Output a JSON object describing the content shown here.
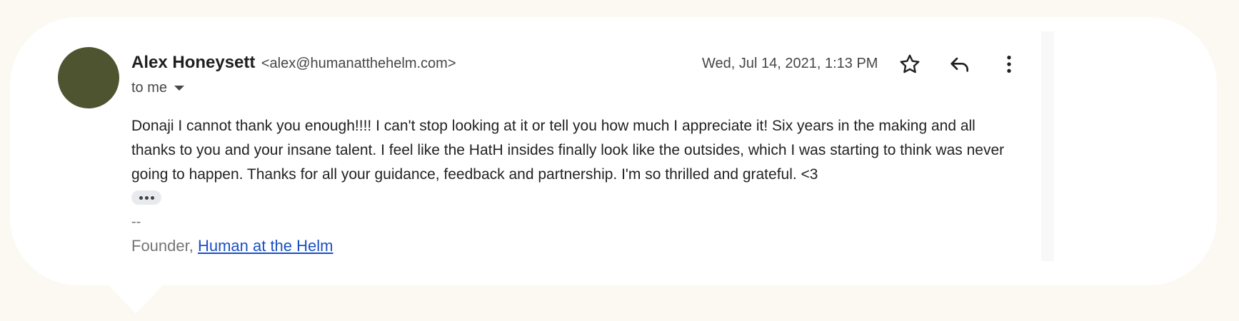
{
  "sender": {
    "name": "Alex Honeysett",
    "email": "<alex@humanatthehelm.com>",
    "avatar_color": "#4f5430"
  },
  "recipient": {
    "label": "to me"
  },
  "date": "Wed, Jul 14, 2021, 1:13 PM",
  "actions": {
    "star_icon": "star-icon",
    "reply_icon": "reply-icon",
    "more_icon": "more-vert-icon"
  },
  "message": {
    "body": "Donaji I cannot thank you enough!!!! I can't stop looking at it or tell you how much I appreciate it! Six years in the making and all thanks to you and your insane talent. I feel like the HatH insides finally look like the outsides, which I was starting to think was never going to happen. Thanks for all your guidance, feedback and partnership. I'm so thrilled and grateful. <3"
  },
  "signature": {
    "dash": "--",
    "prefix": "Founder, ",
    "link_text": "Human at the Helm"
  },
  "colors": {
    "background": "#fcf8f2",
    "card": "#ffffff",
    "link": "#1a4fc4"
  }
}
